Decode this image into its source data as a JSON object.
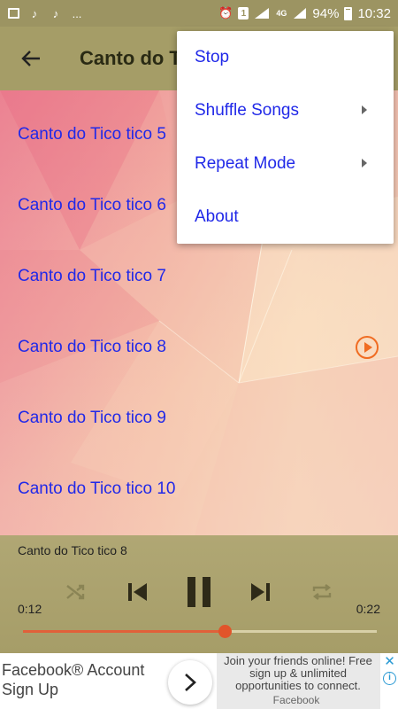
{
  "status_bar": {
    "left_icons": [
      "image-icon",
      "music-note-icon",
      "music-note-icon",
      "more-dots"
    ],
    "more_text": "...",
    "badge_text": "1",
    "network_text": "4G",
    "battery_text": "94%",
    "time": "10:32"
  },
  "app_bar": {
    "title": "Canto do Tico tico"
  },
  "songs": [
    {
      "title": "Canto do Tico tico 5"
    },
    {
      "title": "Canto do Tico tico 6"
    },
    {
      "title": "Canto do Tico tico 7"
    },
    {
      "title": "Canto do Tico tico 8"
    },
    {
      "title": "Canto do Tico tico 9"
    },
    {
      "title": "Canto do Tico tico 10"
    }
  ],
  "playing_index": 3,
  "menu": {
    "items": [
      {
        "label": "Stop",
        "has_submenu": false
      },
      {
        "label": "Shuffle Songs",
        "has_submenu": true
      },
      {
        "label": "Repeat Mode",
        "has_submenu": true
      },
      {
        "label": "About",
        "has_submenu": false
      }
    ]
  },
  "player": {
    "now_playing": "Canto do Tico tico 8",
    "elapsed": "0:12",
    "duration": "0:22",
    "progress_fraction": 0.57
  },
  "ad": {
    "headline": "Facebook® Account Sign Up",
    "body": "Join your friends online! Free sign up & unlimited opportunities to connect.",
    "brand": "Facebook"
  },
  "colors": {
    "accent": "#2129e8",
    "app_bar": "#a59d67",
    "status_bar": "#9c9462",
    "seek": "#e1603a",
    "play_indicator": "#f06c22"
  }
}
